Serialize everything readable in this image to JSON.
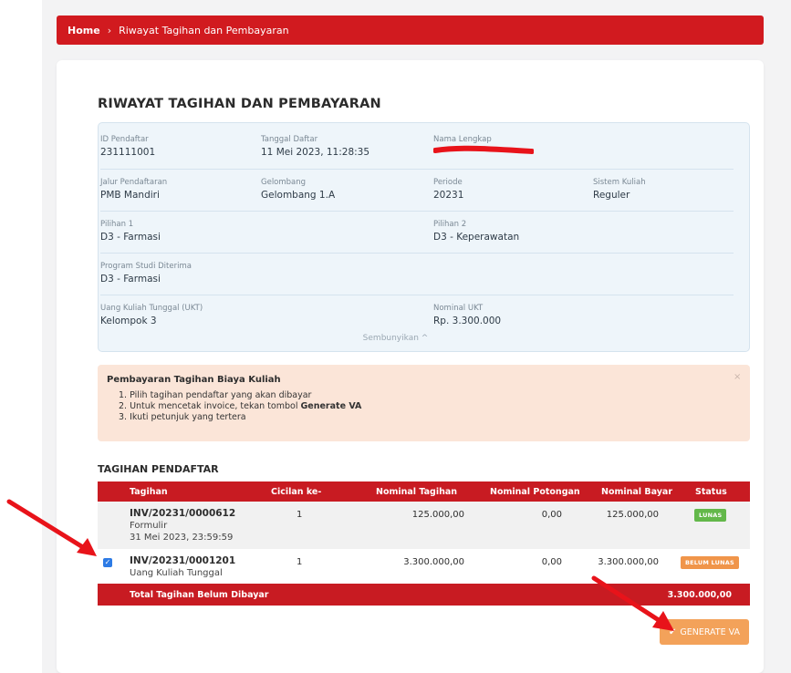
{
  "breadcrumb": {
    "home": "Home",
    "separator": "›",
    "current": "Riwayat Tagihan dan Pembayaran"
  },
  "page_title": "RIWAYAT TAGIHAN DAN PEMBAYARAN",
  "info": {
    "id_pendaftar": {
      "label": "ID Pendaftar",
      "value": "231111001"
    },
    "tanggal_daftar": {
      "label": "Tanggal Daftar",
      "value": "11 Mei 2023, 11:28:35"
    },
    "nama_lengkap": {
      "label": "Nama Lengkap",
      "value": ""
    },
    "jalur": {
      "label": "Jalur Pendaftaran",
      "value": "PMB Mandiri"
    },
    "gelombang": {
      "label": "Gelombang",
      "value": "Gelombang 1.A"
    },
    "periode": {
      "label": "Periode",
      "value": "20231"
    },
    "sistem_kuliah": {
      "label": "Sistem Kuliah",
      "value": "Reguler"
    },
    "pilihan1": {
      "label": "Pilihan 1",
      "value": "D3 - Farmasi"
    },
    "pilihan2": {
      "label": "Pilihan 2",
      "value": "D3 - Keperawatan"
    },
    "prodi_diterima": {
      "label": "Program Studi Diterima",
      "value": "D3 - Farmasi"
    },
    "ukt": {
      "label": "Uang Kuliah Tunggal (UKT)",
      "value": "Kelompok 3"
    },
    "nominal_ukt": {
      "label": "Nominal UKT",
      "value": "Rp. 3.300.000"
    },
    "toggle": "Sembunyikan ^"
  },
  "alert": {
    "title": "Pembayaran Tagihan Biaya Kuliah",
    "step1": "1. Pilih tagihan pendaftar yang akan dibayar",
    "step2_prefix": "2. Untuk mencetak invoice, tekan tombol ",
    "step2_bold": "Generate VA",
    "step3": "3. Ikuti petunjuk yang tertera",
    "close": "×"
  },
  "section_title": "TAGIHAN PENDAFTAR",
  "table": {
    "headers": [
      "Tagihan",
      "Cicilan ke-",
      "Nominal Tagihan",
      "Nominal Potongan",
      "Nominal Bayar",
      "Status"
    ],
    "rows": [
      {
        "invoice": "INV/20231/0000612",
        "desc": "Formulir",
        "date": "31 Mei 2023, 23:59:59",
        "cicilan": "1",
        "nominal": "125.000,00",
        "potongan": "0,00",
        "bayar": "125.000,00",
        "status": "LUNAS"
      },
      {
        "invoice": "INV/20231/0001201",
        "desc": "Uang Kuliah Tunggal",
        "cicilan": "1",
        "nominal": "3.300.000,00",
        "potongan": "0,00",
        "bayar": "3.300.000,00",
        "status": "BELUM LUNAS",
        "checked": "✓"
      }
    ],
    "total_label": "Total Tagihan Belum Dibayar",
    "total_value": "3.300.000,00"
  },
  "generate_button": {
    "icon": "✔",
    "label": "GENERATE VA"
  },
  "colors": {
    "brand_red": "#d11a1f",
    "arrow_red": "#e8131a",
    "badge_green": "#63b84a",
    "badge_orange": "#f0954a",
    "button_orange": "#f3a25a"
  }
}
